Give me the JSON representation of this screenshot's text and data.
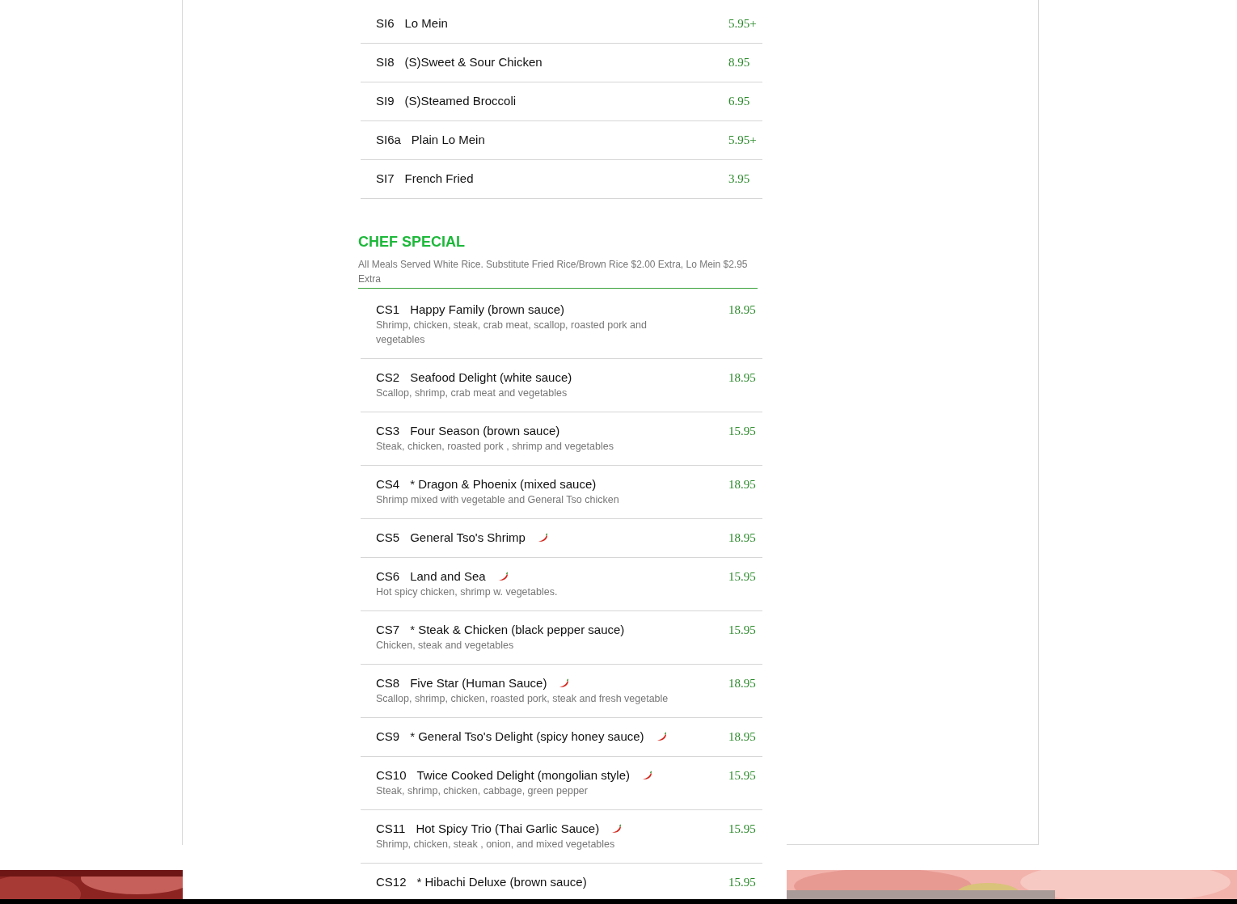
{
  "side_items": [
    {
      "code": "SI6",
      "name": "Lo Mein",
      "price": "5.95+"
    },
    {
      "code": "SI8",
      "name": "(S)Sweet & Sour Chicken",
      "price": "8.95"
    },
    {
      "code": "SI9",
      "name": "(S)Steamed Broccoli",
      "price": "6.95"
    },
    {
      "code": "SI6a",
      "name": "Plain Lo Mein",
      "price": "5.95+"
    },
    {
      "code": "SI7",
      "name": "French Fried",
      "price": "3.95"
    }
  ],
  "chef_special": {
    "title": "CHEF SPECIAL",
    "note": "All Meals Served White Rice. Substitute Fried Rice/Brown Rice $2.00 Extra, Lo Mein $2.95 Extra",
    "items": [
      {
        "code": "CS1",
        "name": "Happy Family (brown sauce)",
        "description": "Shrimp, chicken, steak, crab meat, scallop, roasted pork and vegetables",
        "price": "18.95",
        "spicy": false
      },
      {
        "code": "CS2",
        "name": "Seafood Delight (white sauce)",
        "description": "Scallop, shrimp, crab meat and vegetables",
        "price": "18.95",
        "spicy": false
      },
      {
        "code": "CS3",
        "name": "Four Season (brown sauce)",
        "description": "Steak, chicken, roasted pork , shrimp and vegetables",
        "price": "15.95",
        "spicy": false
      },
      {
        "code": "CS4",
        "name": "* Dragon & Phoenix (mixed sauce)",
        "description": "Shrimp mixed with vegetable and General Tso chicken",
        "price": "18.95",
        "spicy": false
      },
      {
        "code": "CS5",
        "name": "General Tso's Shrimp",
        "price": "18.95",
        "spicy": true
      },
      {
        "code": "CS6",
        "name": "Land and Sea",
        "description": "Hot spicy chicken, shrimp w. vegetables.",
        "price": "15.95",
        "spicy": true
      },
      {
        "code": "CS7",
        "name": "* Steak & Chicken (black pepper sauce)",
        "description": "Chicken, steak and vegetables",
        "price": "15.95",
        "spicy": false
      },
      {
        "code": "CS8",
        "name": "Five Star (Human Sauce)",
        "description": "Scallop, shrimp, chicken, roasted pork, steak and fresh vegetable",
        "price": "18.95",
        "spicy": true
      },
      {
        "code": "CS9",
        "name": "* General Tso's Delight (spicy honey sauce)",
        "price": "18.95",
        "spicy": true
      },
      {
        "code": "CS10",
        "name": "Twice Cooked Delight (mongolian style)",
        "description": "Steak, shrimp, chicken, cabbage, green pepper",
        "price": "15.95",
        "spicy": true
      },
      {
        "code": "CS11",
        "name": "Hot Spicy Trio (Thai Garlic Sauce)",
        "description": "Shrimp, chicken, steak , onion, and mixed vegetables",
        "price": "15.95",
        "spicy": true
      },
      {
        "code": "CS12",
        "name": "* Hibachi Deluxe (brown sauce)",
        "price": "15.95",
        "spicy": false
      }
    ]
  }
}
